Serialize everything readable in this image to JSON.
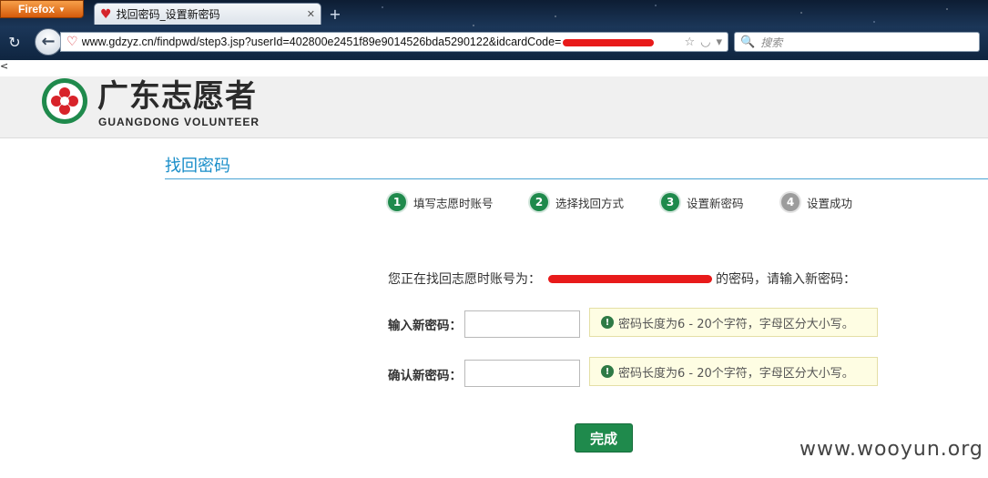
{
  "browser": {
    "app_button": "Firefox",
    "tab_title": "找回密码_设置新密码",
    "url_text": "www.gdzyz.cn/findpwd/step3.jsp?userId=402800e2451f89e9014526bda5290122&idcardCode=",
    "search_placeholder": "搜索"
  },
  "page": {
    "back_link": "<",
    "brand_cn": "广东志愿者",
    "brand_en": "GUANGDONG VOLUNTEER",
    "section_title": "找回密码",
    "steps": [
      {
        "num": "1",
        "label": "填写志愿时账号",
        "state": "done"
      },
      {
        "num": "2",
        "label": "选择找回方式",
        "state": "done"
      },
      {
        "num": "3",
        "label": "设置新密码",
        "state": "done"
      },
      {
        "num": "4",
        "label": "设置成功",
        "state": "todo"
      }
    ],
    "account_prefix": "您正在找回志愿时账号为：",
    "account_suffix": "的密码，请输入新密码：",
    "new_pw_label": "输入新密码：",
    "confirm_pw_label": "确认新密码：",
    "pw_tip": "密码长度为6 - 20个字符，字母区分大小写。",
    "submit_label": "完成",
    "watermark": "www.wooyun.org"
  },
  "colors": {
    "accent_green": "#1f8a4c",
    "title_blue": "#1a8ec9",
    "redaction_red": "#e81a1a"
  }
}
